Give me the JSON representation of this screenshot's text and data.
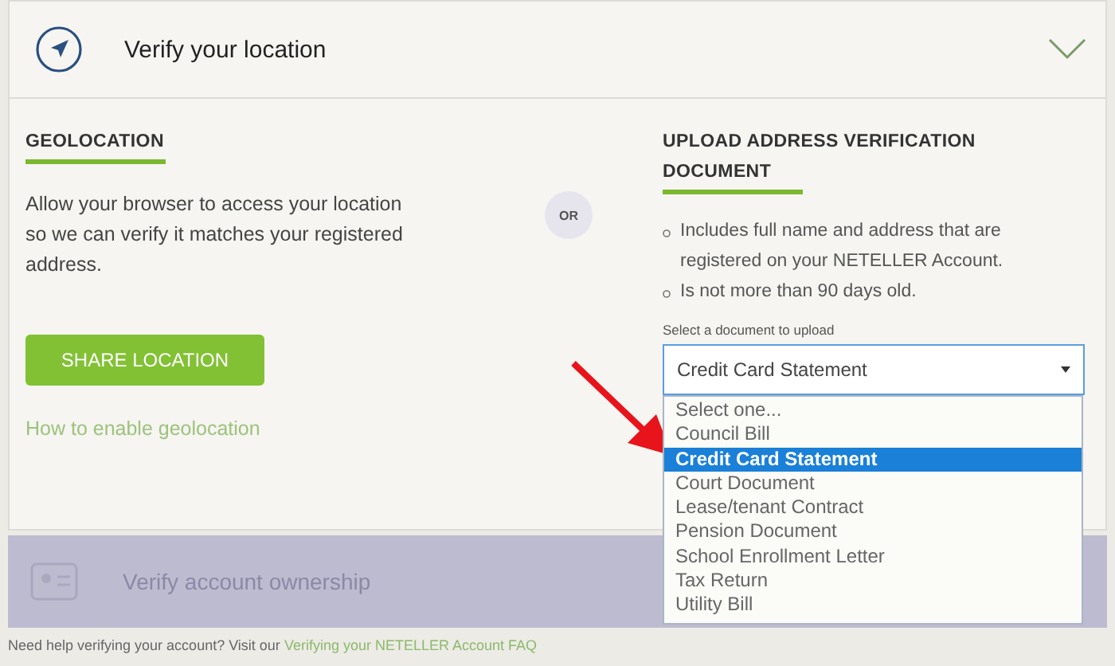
{
  "header": {
    "title": "Verify your location",
    "expanded": true
  },
  "geolocation": {
    "heading": "GEOLOCATION",
    "text": "Allow your browser to access your location so we can verify it matches your registered address.",
    "button": "SHARE LOCATION",
    "link": "How to enable geolocation"
  },
  "separator": "OR",
  "upload": {
    "heading": "UPLOAD ADDRESS VERIFICATION DOCUMENT",
    "requirements": [
      "Includes full name and address that are registered on your NETELLER Account.",
      "Is not more than 90 days old."
    ],
    "select_label": "Select a document to upload",
    "select_value": "Credit Card Statement",
    "options": [
      {
        "label": "Select one...",
        "selected": false
      },
      {
        "label": "Council Bill",
        "selected": false
      },
      {
        "label": "Credit Card Statement",
        "selected": true
      },
      {
        "label": "Court Document",
        "selected": false
      },
      {
        "label": "Lease/tenant Contract",
        "selected": false
      },
      {
        "label": "Pension Document",
        "selected": false
      },
      {
        "label": "School Enrollment Letter",
        "selected": false
      },
      {
        "label": "Tax Return",
        "selected": false
      },
      {
        "label": "Utility Bill",
        "selected": false
      }
    ]
  },
  "next_step": {
    "title": "Verify account ownership",
    "disabled": true
  },
  "footer": {
    "text": "Need help verifying your account? Visit our",
    "link": "Verifying your NETELLER Account FAQ"
  }
}
